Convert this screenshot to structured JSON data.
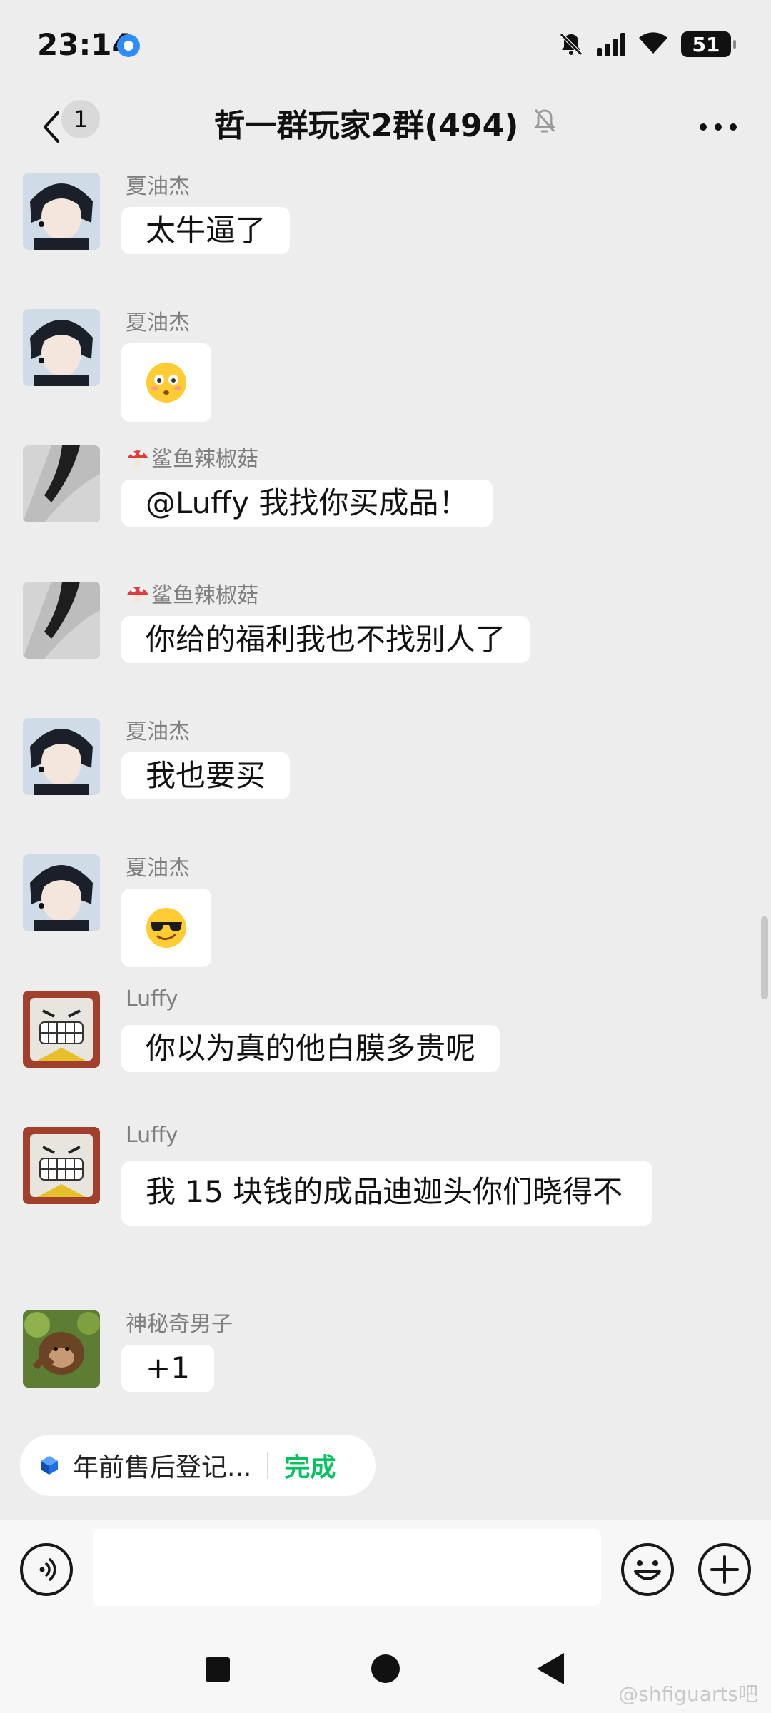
{
  "status_bar": {
    "time": "23:14",
    "battery": "51"
  },
  "header": {
    "unread_count": "1",
    "title": "哲一群玩家2群(494)"
  },
  "messages": [
    {
      "sender": "夏油杰",
      "text": "太牛逼了",
      "avatar": "geto-avatar"
    },
    {
      "sender": "夏油杰",
      "emoji": "😳",
      "avatar": "geto-avatar"
    },
    {
      "sender": "鲨鱼辣椒菇",
      "text": "@Luffy  我找你买成品！",
      "avatar": "shark-avatar"
    },
    {
      "sender": "鲨鱼辣椒菇",
      "text": "你给的福利我也不找别人了",
      "avatar": "shark-avatar"
    },
    {
      "sender": "夏油杰",
      "text": "我也要买",
      "avatar": "geto-avatar"
    },
    {
      "sender": "夏油杰",
      "emoji": "😎",
      "avatar": "geto-avatar"
    },
    {
      "sender": "Luffy",
      "text": "你以为真的他白膜多贵呢",
      "avatar": "luffy-avatar"
    },
    {
      "sender": "Luffy",
      "text": "我 15 块钱的成品迪迦头你们晓得不",
      "avatar": "luffy-avatar"
    },
    {
      "sender": "神秘奇男子",
      "text": "+1",
      "avatar": "monkey-avatar"
    }
  ],
  "task": {
    "text": "年前售后登记...",
    "status": "完成"
  },
  "input": {
    "value": "",
    "placeholder": ""
  },
  "watermark": "@shfiguarts吧"
}
